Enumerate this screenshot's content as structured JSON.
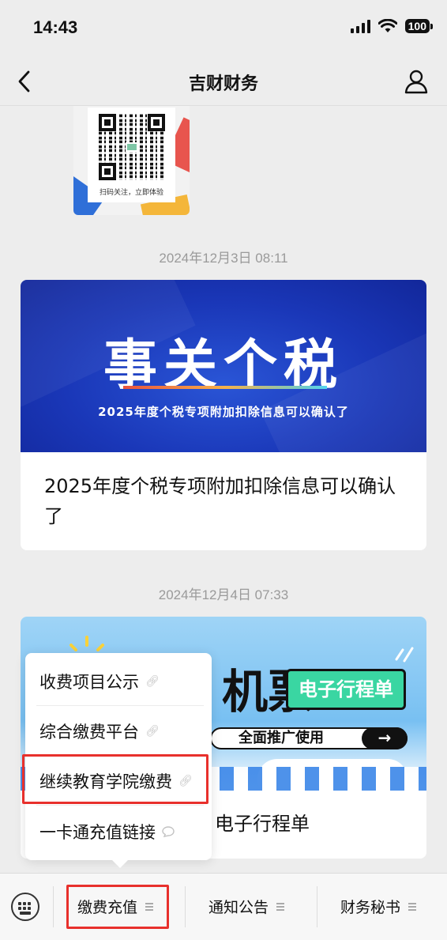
{
  "status_bar": {
    "time": "14:43",
    "battery": "100"
  },
  "nav": {
    "title": "吉财财务"
  },
  "qr_card": {
    "caption": "扫码关注，立即体验"
  },
  "messages": [
    {
      "timestamp": "2024年12月3日 08:11",
      "banner_title": "事关个税",
      "banner_subtitle": "2025年度个税专项附加扣除信息可以确认了",
      "title": "2025年度个税专项附加扣除信息可以确认了"
    },
    {
      "timestamp": "2024年12月4日 07:33",
      "banner_big_char": "机票",
      "banner_pill": "电子行程单",
      "banner_strip": "全面推广使用",
      "title_visible": "电子行程单"
    }
  ],
  "popup_menu": {
    "items": [
      {
        "label": "收费项目公示",
        "icon": "link-icon"
      },
      {
        "label": "综合缴费平台",
        "icon": "link-icon"
      },
      {
        "label": "继续教育学院缴费",
        "icon": "link-icon",
        "highlighted": true
      },
      {
        "label": "一卡通充值链接",
        "icon": "chat-bubble-icon"
      }
    ]
  },
  "bottom_menu": {
    "tabs": [
      {
        "label": "缴费充值",
        "highlighted": true
      },
      {
        "label": "通知公告"
      },
      {
        "label": "财务秘书"
      }
    ]
  },
  "colors": {
    "highlight": "#e8302c",
    "accent_blue": "#1a37b8",
    "background": "#ededed"
  }
}
